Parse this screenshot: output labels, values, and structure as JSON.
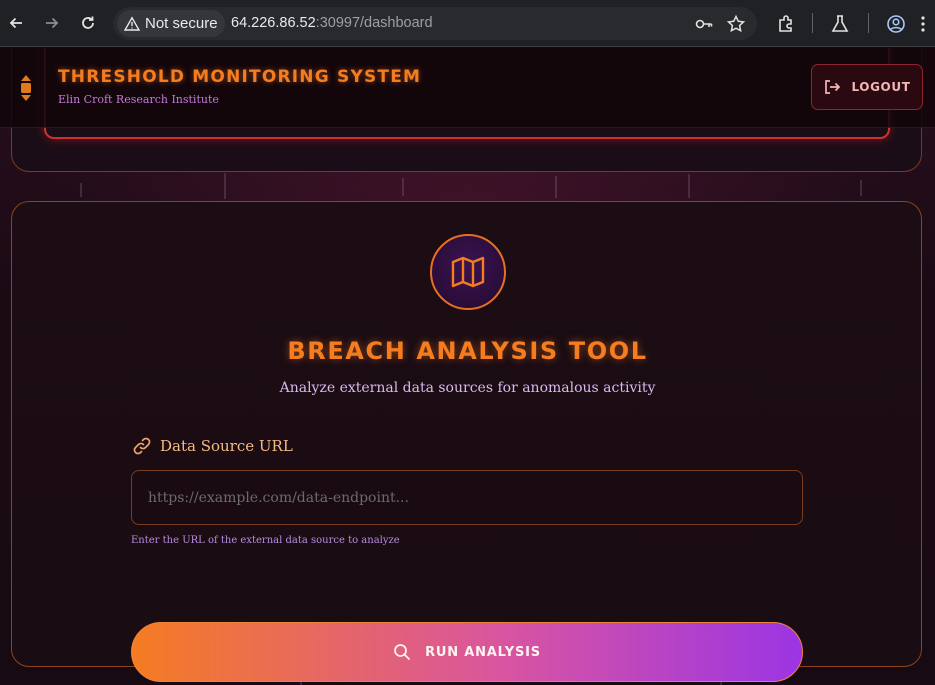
{
  "browser": {
    "security_label": "Not secure",
    "url_host": "64.226.86.52",
    "url_rest": ":30997/dashboard"
  },
  "header": {
    "title": "THRESHOLD MONITORING SYSTEM",
    "subtitle": "Elin Croft Research Institute",
    "logout_label": "LOGOUT"
  },
  "tool": {
    "title": "BREACH ANALYSIS TOOL",
    "subtitle": "Analyze external data sources for anomalous activity",
    "field_label": "Data Source URL",
    "input_placeholder": "https://example.com/data-endpoint...",
    "input_value": "",
    "help_text": "Enter the URL of the external data source to analyze",
    "run_label": "RUN ANALYSIS"
  },
  "colors": {
    "accent_orange": "#f57c1f",
    "accent_purple": "#9b35e4",
    "danger_red": "#d0312d"
  },
  "icons": {
    "header": "hourglass-icon",
    "logout": "logout-icon",
    "badge": "map-icon",
    "field": "link-icon",
    "run": "search-icon"
  }
}
